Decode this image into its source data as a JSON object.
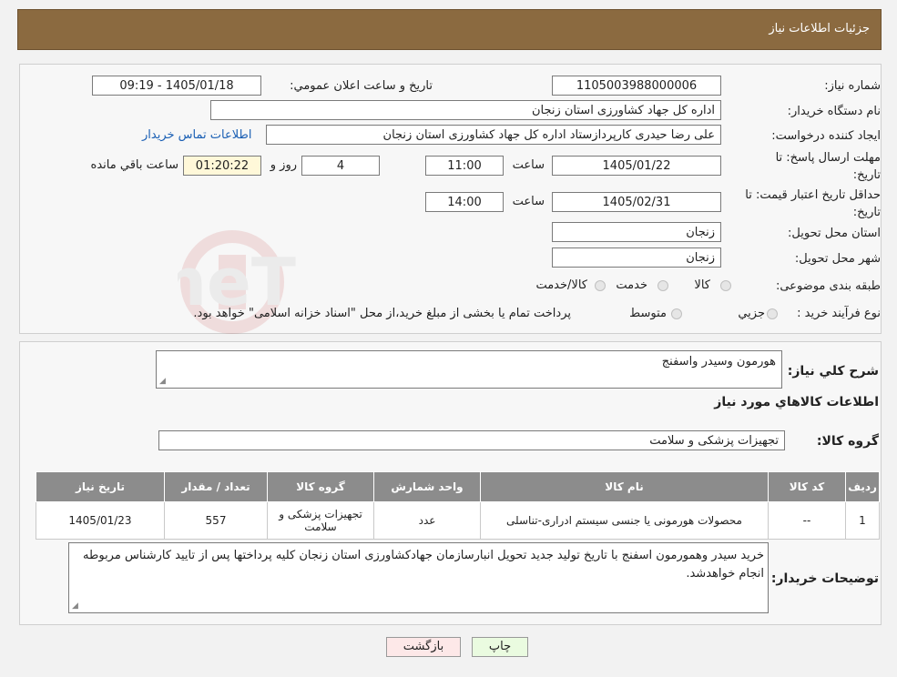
{
  "header": {
    "title": "جزئیات اطلاعات نیاز"
  },
  "form": {
    "need_number_label": "شماره نیاز:",
    "need_number": "1105003988000006",
    "announce_label": "تاریخ و ساعت اعلان عمومي:",
    "announce_value": "1405/01/18 - 09:19",
    "buyer_org_label": "نام دستگاه خریدار:",
    "buyer_org": "اداره کل جهاد کشاورزی استان زنجان",
    "creator_label": "ایجاد کننده درخواست:",
    "creator": "علی رضا حیدری کارپردازستاد اداره کل جهاد کشاورزی استان زنجان",
    "contact_link": "اطلاعات تماس خریدار",
    "deadline_label": "مهلت ارسال پاسخ: تا تاریخ:",
    "deadline_date": "1405/01/22",
    "time_label": "ساعت",
    "deadline_time": "11:00",
    "days": "4",
    "days_label": "روز و",
    "remaining": "01:20:22",
    "remaining_label": "ساعت باقي مانده",
    "validity_label": "حداقل تاریخ اعتبار قیمت: تا تاریخ:",
    "validity_date": "1405/02/31",
    "validity_time": "14:00",
    "province_label": "استان محل تحویل:",
    "province": "زنجان",
    "city_label": "شهر محل تحویل:",
    "city": "زنجان",
    "category_label": "طبقه بندی موضوعی:",
    "category_options": [
      "کالا",
      "خدمت",
      "کالا/خدمت"
    ],
    "purchase_type_label": "نوع فرآیند خرید :",
    "purchase_type_options": [
      "جزيي",
      "متوسط"
    ],
    "purchase_note": "پرداخت تمام یا بخشی از مبلغ خرید،از محل \"اسناد خزانه اسلامی\" خواهد بود."
  },
  "details": {
    "summary_label": "شرح کلي نياز:",
    "summary": "هورمون وسیدر واسفنج",
    "items_heading": "اطلاعات کالاهاي مورد نياز",
    "group_label": "گروه کالا:",
    "group": "تجهیزات پزشکی و سلامت",
    "table_headers": [
      "رديف",
      "کد کالا",
      "نام کالا",
      "واحد شمارش",
      "گروه کالا",
      "تعداد / مقدار",
      "تاریخ نیاز"
    ],
    "rows": [
      [
        "1",
        "--",
        "محصولات هورمونی یا جنسی سیستم ادراری-تناسلی",
        "عدد",
        "تجهیزات پزشکی و سلامت",
        "557",
        "1405/01/23"
      ]
    ],
    "buyer_notes_label": "توضیحات خریدار:",
    "buyer_notes": "خرید سیدر وهمورمون اسفنج با تاریخ تولید جدید تحویل انبارسازمان جهادکشاورزی استان زنجان کلیه پرداختها پس از تایید کارشناس مربوطه انجام خواهدشد."
  },
  "buttons": {
    "print": "چاپ",
    "back": "بازگشت"
  },
  "colors": {
    "header_bg": "#8b6a40",
    "table_header_bg": "#8c8c8c",
    "print_bg": "#eafbe0",
    "back_bg": "#fde8e8"
  }
}
